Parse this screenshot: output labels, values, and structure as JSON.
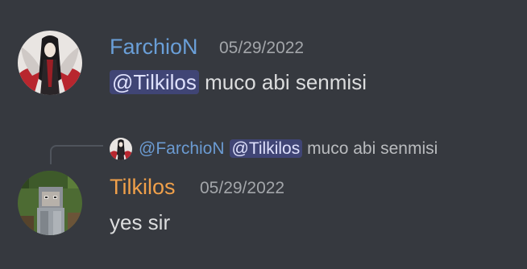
{
  "messages": [
    {
      "author": "FarchioN",
      "author_color": "#6a9fd8",
      "timestamp": "05/29/2022",
      "mention": "@Tilkilos",
      "text": " muco abi senmisi"
    },
    {
      "reply": {
        "author": "@FarchioN",
        "mention": "@Tilkilos",
        "text": " muco abi senmisi"
      },
      "author": "Tilkilos",
      "author_color": "#f0a04a",
      "timestamp": "05/29/2022",
      "text": "yes sir"
    }
  ]
}
